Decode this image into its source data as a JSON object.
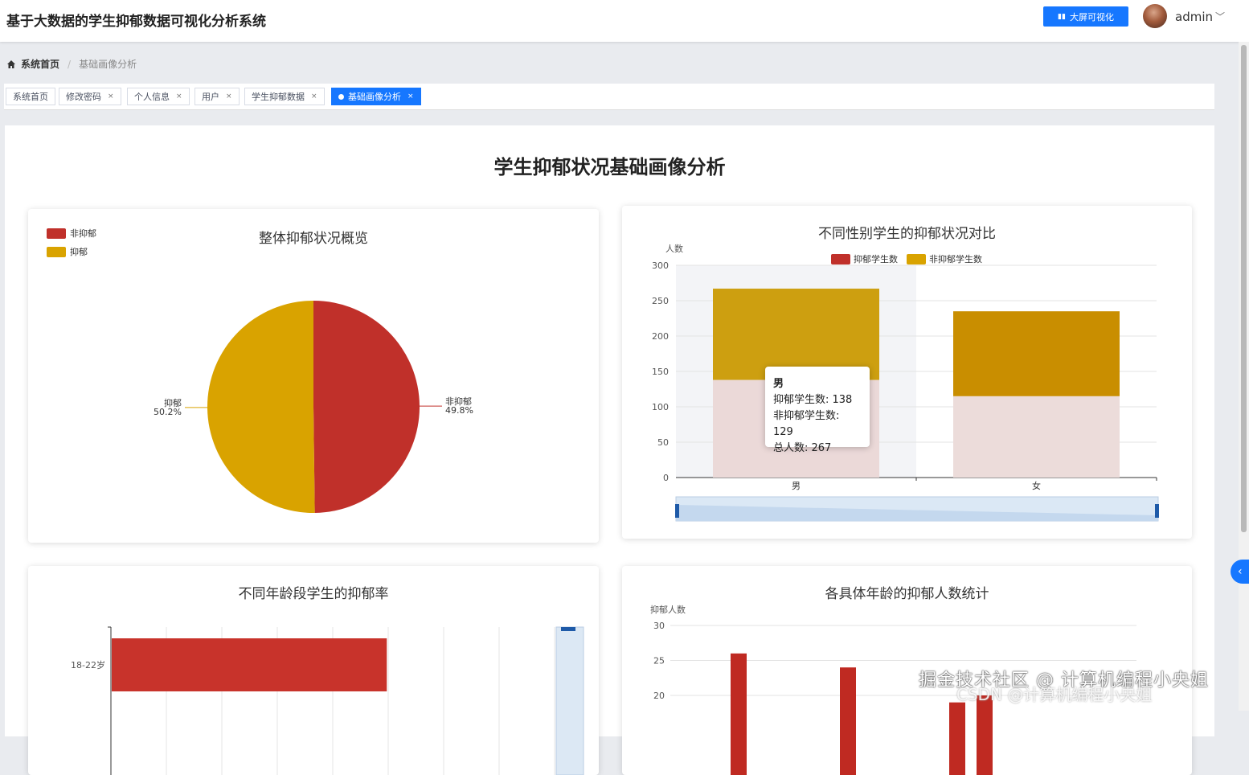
{
  "app": {
    "title": "基于大数据的学生抑郁数据可视化分析系统",
    "bigscreen_label": "大屏可视化",
    "username": "admin"
  },
  "breadcrumb": {
    "home": "系统首页",
    "current": "基础画像分析"
  },
  "tabs": [
    {
      "label": "系统首页",
      "closable": false,
      "active": false
    },
    {
      "label": "修改密码",
      "closable": true,
      "active": false
    },
    {
      "label": "个人信息",
      "closable": true,
      "active": false
    },
    {
      "label": "用户",
      "closable": true,
      "active": false
    },
    {
      "label": "学生抑郁数据",
      "closable": true,
      "active": false
    },
    {
      "label": "基础画像分析",
      "closable": true,
      "active": true
    }
  ],
  "page_title": "学生抑郁状况基础画像分析",
  "colors": {
    "red": "#c0302a",
    "gold": "#d9a300",
    "accent": "#1677ff"
  },
  "charts": {
    "overview": {
      "title": "整体抑郁状况概览"
    },
    "gender": {
      "title": "不同性别学生的抑郁状况对比",
      "ylabel": "人数"
    },
    "age_group": {
      "title": "不同年龄段学生的抑郁率"
    },
    "age_count": {
      "title": "各具体年龄的抑郁人数统计",
      "ylabel": "抑郁人数"
    }
  },
  "tooltip": {
    "title": "男",
    "line1": "抑郁学生数: 138",
    "line2": "非抑郁学生数: 129",
    "line3": "总人数: 267"
  },
  "watermark": "掘金技术社区 @ 计算机编程小央姐",
  "watermark2": "CSDN @计算机编程小央姐",
  "chart_data": [
    {
      "type": "pie",
      "title": "整体抑郁状况概览",
      "labels": [
        "非抑郁",
        "抑郁"
      ],
      "values": [
        49.8,
        50.2
      ],
      "percent_labels": [
        "49.8%",
        "50.2%"
      ],
      "colors": [
        "#c0302a",
        "#d9a300"
      ],
      "legend": [
        "非抑郁",
        "抑郁"
      ]
    },
    {
      "type": "bar",
      "title": "不同性别学生的抑郁状况对比",
      "categories": [
        "男",
        "女"
      ],
      "series": [
        {
          "name": "抑郁学生数",
          "values": [
            138,
            115
          ],
          "color": "#c0302a"
        },
        {
          "name": "非抑郁学生数",
          "values": [
            129,
            120
          ],
          "color": "#d9a300"
        }
      ],
      "stacked": true,
      "ylabel": "人数",
      "ylim": [
        0,
        300
      ],
      "yticks": [
        0,
        50,
        100,
        150,
        200,
        250,
        300
      ]
    },
    {
      "type": "bar",
      "title": "不同年龄段学生的抑郁率",
      "orientation": "horizontal",
      "categories": [
        "18-22岁"
      ],
      "values": [
        0.62
      ]
    },
    {
      "type": "bar",
      "title": "各具体年龄的抑郁人数统计",
      "ylabel": "抑郁人数",
      "yticks": [
        20,
        25,
        30
      ],
      "values_visible": [
        26,
        24,
        19,
        20
      ]
    }
  ]
}
